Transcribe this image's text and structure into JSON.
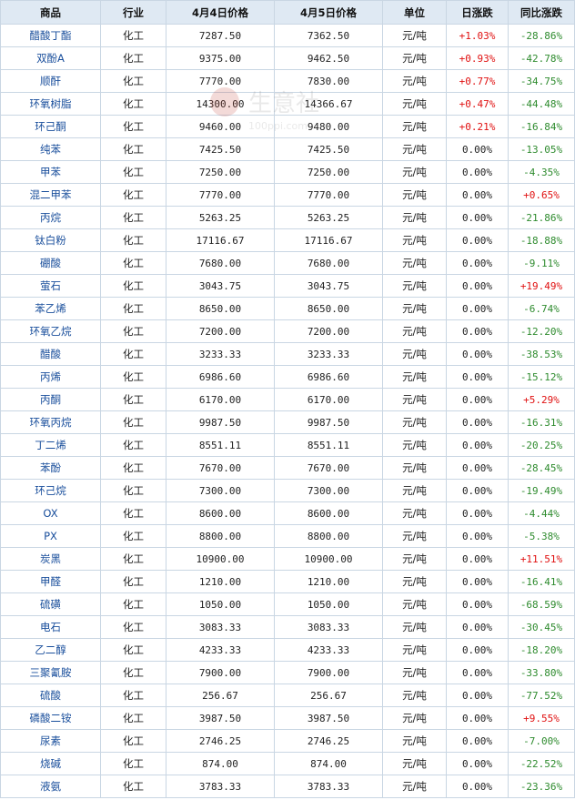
{
  "headers": [
    "商品",
    "行业",
    "4月4日价格",
    "4月5日价格",
    "单位",
    "日涨跌",
    "同比涨跌"
  ],
  "colors": {
    "up": "#e01010",
    "down": "#2e8b2e",
    "link": "#1a4f9c",
    "header_bg": "#dfe9f3",
    "border": "#c9d6e3"
  },
  "watermark": {
    "text": "生意社",
    "url_fragment": "100ppi.com"
  },
  "rows": [
    {
      "name": "醋酸丁酯",
      "industry": "化工",
      "p1": "7287.50",
      "p2": "7362.50",
      "unit": "元/吨",
      "day": "+1.03%",
      "yoy": "-28.86%"
    },
    {
      "name": "双酚A",
      "industry": "化工",
      "p1": "9375.00",
      "p2": "9462.50",
      "unit": "元/吨",
      "day": "+0.93%",
      "yoy": "-42.78%"
    },
    {
      "name": "顺酐",
      "industry": "化工",
      "p1": "7770.00",
      "p2": "7830.00",
      "unit": "元/吨",
      "day": "+0.77%",
      "yoy": "-34.75%"
    },
    {
      "name": "环氧树脂",
      "industry": "化工",
      "p1": "14300.00",
      "p2": "14366.67",
      "unit": "元/吨",
      "day": "+0.47%",
      "yoy": "-44.48%"
    },
    {
      "name": "环己酮",
      "industry": "化工",
      "p1": "9460.00",
      "p2": "9480.00",
      "unit": "元/吨",
      "day": "+0.21%",
      "yoy": "-16.84%"
    },
    {
      "name": "纯苯",
      "industry": "化工",
      "p1": "7425.50",
      "p2": "7425.50",
      "unit": "元/吨",
      "day": "0.00%",
      "yoy": "-13.05%"
    },
    {
      "name": "甲苯",
      "industry": "化工",
      "p1": "7250.00",
      "p2": "7250.00",
      "unit": "元/吨",
      "day": "0.00%",
      "yoy": "-4.35%"
    },
    {
      "name": "混二甲苯",
      "industry": "化工",
      "p1": "7770.00",
      "p2": "7770.00",
      "unit": "元/吨",
      "day": "0.00%",
      "yoy": "+0.65%"
    },
    {
      "name": "丙烷",
      "industry": "化工",
      "p1": "5263.25",
      "p2": "5263.25",
      "unit": "元/吨",
      "day": "0.00%",
      "yoy": "-21.86%"
    },
    {
      "name": "钛白粉",
      "industry": "化工",
      "p1": "17116.67",
      "p2": "17116.67",
      "unit": "元/吨",
      "day": "0.00%",
      "yoy": "-18.88%"
    },
    {
      "name": "硼酸",
      "industry": "化工",
      "p1": "7680.00",
      "p2": "7680.00",
      "unit": "元/吨",
      "day": "0.00%",
      "yoy": "-9.11%"
    },
    {
      "name": "萤石",
      "industry": "化工",
      "p1": "3043.75",
      "p2": "3043.75",
      "unit": "元/吨",
      "day": "0.00%",
      "yoy": "+19.49%"
    },
    {
      "name": "苯乙烯",
      "industry": "化工",
      "p1": "8650.00",
      "p2": "8650.00",
      "unit": "元/吨",
      "day": "0.00%",
      "yoy": "-6.74%"
    },
    {
      "name": "环氧乙烷",
      "industry": "化工",
      "p1": "7200.00",
      "p2": "7200.00",
      "unit": "元/吨",
      "day": "0.00%",
      "yoy": "-12.20%"
    },
    {
      "name": "醋酸",
      "industry": "化工",
      "p1": "3233.33",
      "p2": "3233.33",
      "unit": "元/吨",
      "day": "0.00%",
      "yoy": "-38.53%"
    },
    {
      "name": "丙烯",
      "industry": "化工",
      "p1": "6986.60",
      "p2": "6986.60",
      "unit": "元/吨",
      "day": "0.00%",
      "yoy": "-15.12%"
    },
    {
      "name": "丙酮",
      "industry": "化工",
      "p1": "6170.00",
      "p2": "6170.00",
      "unit": "元/吨",
      "day": "0.00%",
      "yoy": "+5.29%"
    },
    {
      "name": "环氧丙烷",
      "industry": "化工",
      "p1": "9987.50",
      "p2": "9987.50",
      "unit": "元/吨",
      "day": "0.00%",
      "yoy": "-16.31%"
    },
    {
      "name": "丁二烯",
      "industry": "化工",
      "p1": "8551.11",
      "p2": "8551.11",
      "unit": "元/吨",
      "day": "0.00%",
      "yoy": "-20.25%"
    },
    {
      "name": "苯酚",
      "industry": "化工",
      "p1": "7670.00",
      "p2": "7670.00",
      "unit": "元/吨",
      "day": "0.00%",
      "yoy": "-28.45%"
    },
    {
      "name": "环己烷",
      "industry": "化工",
      "p1": "7300.00",
      "p2": "7300.00",
      "unit": "元/吨",
      "day": "0.00%",
      "yoy": "-19.49%"
    },
    {
      "name": "OX",
      "industry": "化工",
      "p1": "8600.00",
      "p2": "8600.00",
      "unit": "元/吨",
      "day": "0.00%",
      "yoy": "-4.44%"
    },
    {
      "name": "PX",
      "industry": "化工",
      "p1": "8800.00",
      "p2": "8800.00",
      "unit": "元/吨",
      "day": "0.00%",
      "yoy": "-5.38%"
    },
    {
      "name": "炭黑",
      "industry": "化工",
      "p1": "10900.00",
      "p2": "10900.00",
      "unit": "元/吨",
      "day": "0.00%",
      "yoy": "+11.51%"
    },
    {
      "name": "甲醛",
      "industry": "化工",
      "p1": "1210.00",
      "p2": "1210.00",
      "unit": "元/吨",
      "day": "0.00%",
      "yoy": "-16.41%"
    },
    {
      "name": "硫磺",
      "industry": "化工",
      "p1": "1050.00",
      "p2": "1050.00",
      "unit": "元/吨",
      "day": "0.00%",
      "yoy": "-68.59%"
    },
    {
      "name": "电石",
      "industry": "化工",
      "p1": "3083.33",
      "p2": "3083.33",
      "unit": "元/吨",
      "day": "0.00%",
      "yoy": "-30.45%"
    },
    {
      "name": "乙二醇",
      "industry": "化工",
      "p1": "4233.33",
      "p2": "4233.33",
      "unit": "元/吨",
      "day": "0.00%",
      "yoy": "-18.20%"
    },
    {
      "name": "三聚氰胺",
      "industry": "化工",
      "p1": "7900.00",
      "p2": "7900.00",
      "unit": "元/吨",
      "day": "0.00%",
      "yoy": "-33.80%"
    },
    {
      "name": "硫酸",
      "industry": "化工",
      "p1": "256.67",
      "p2": "256.67",
      "unit": "元/吨",
      "day": "0.00%",
      "yoy": "-77.52%"
    },
    {
      "name": "磷酸二铵",
      "industry": "化工",
      "p1": "3987.50",
      "p2": "3987.50",
      "unit": "元/吨",
      "day": "0.00%",
      "yoy": "+9.55%"
    },
    {
      "name": "尿素",
      "industry": "化工",
      "p1": "2746.25",
      "p2": "2746.25",
      "unit": "元/吨",
      "day": "0.00%",
      "yoy": "-7.00%"
    },
    {
      "name": "烧碱",
      "industry": "化工",
      "p1": "874.00",
      "p2": "874.00",
      "unit": "元/吨",
      "day": "0.00%",
      "yoy": "-22.52%"
    },
    {
      "name": "液氨",
      "industry": "化工",
      "p1": "3783.33",
      "p2": "3783.33",
      "unit": "元/吨",
      "day": "0.00%",
      "yoy": "-23.36%"
    }
  ]
}
